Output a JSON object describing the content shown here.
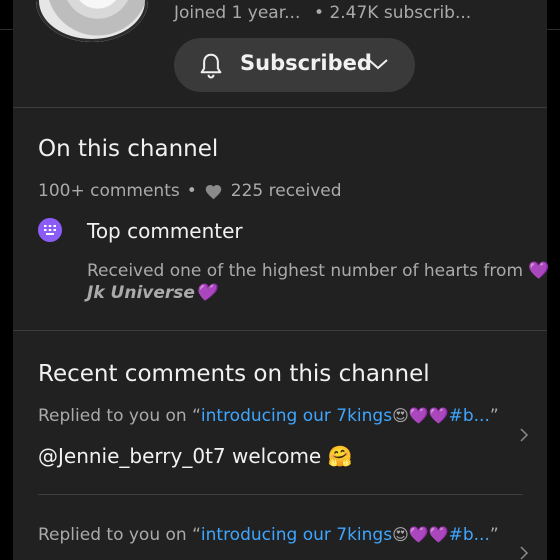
{
  "header": {
    "joined": "Joined 1 year...",
    "separator": "•",
    "subscribers": "2.47K subscrib...",
    "subscribe_button_label": "Subscribed"
  },
  "channel_section": {
    "title": "On this channel",
    "comments_count": "100+ comments",
    "dot": "•",
    "hearts_received": "225 received",
    "badge_title": "Top commenter",
    "badge_desc": "Received one of the highest number of hearts from",
    "badge_desc_emoji": "💜",
    "badge_name": "Jk Universe",
    "badge_name_emoji": "💜"
  },
  "recent_section": {
    "title": "Recent comments on this channel",
    "items": [
      {
        "prefix": "Replied to you on “",
        "video_link": "introducing our 7kings",
        "emojis": "😍💜💜",
        "link_tail": "#b...",
        "suffix": "”",
        "comment": "@Jennie_berry_0t7 welcome 🤗"
      },
      {
        "prefix": "Replied to you on “",
        "video_link": "introducing our 7kings",
        "emojis": "😍💜💜",
        "link_tail": "#b...",
        "suffix": "”",
        "comment": ""
      }
    ]
  },
  "colors": {
    "background": "#000000",
    "panel": "#212121",
    "button": "#3a3a3a",
    "link": "#3ea6ff",
    "badge": "#8b5cf6"
  }
}
